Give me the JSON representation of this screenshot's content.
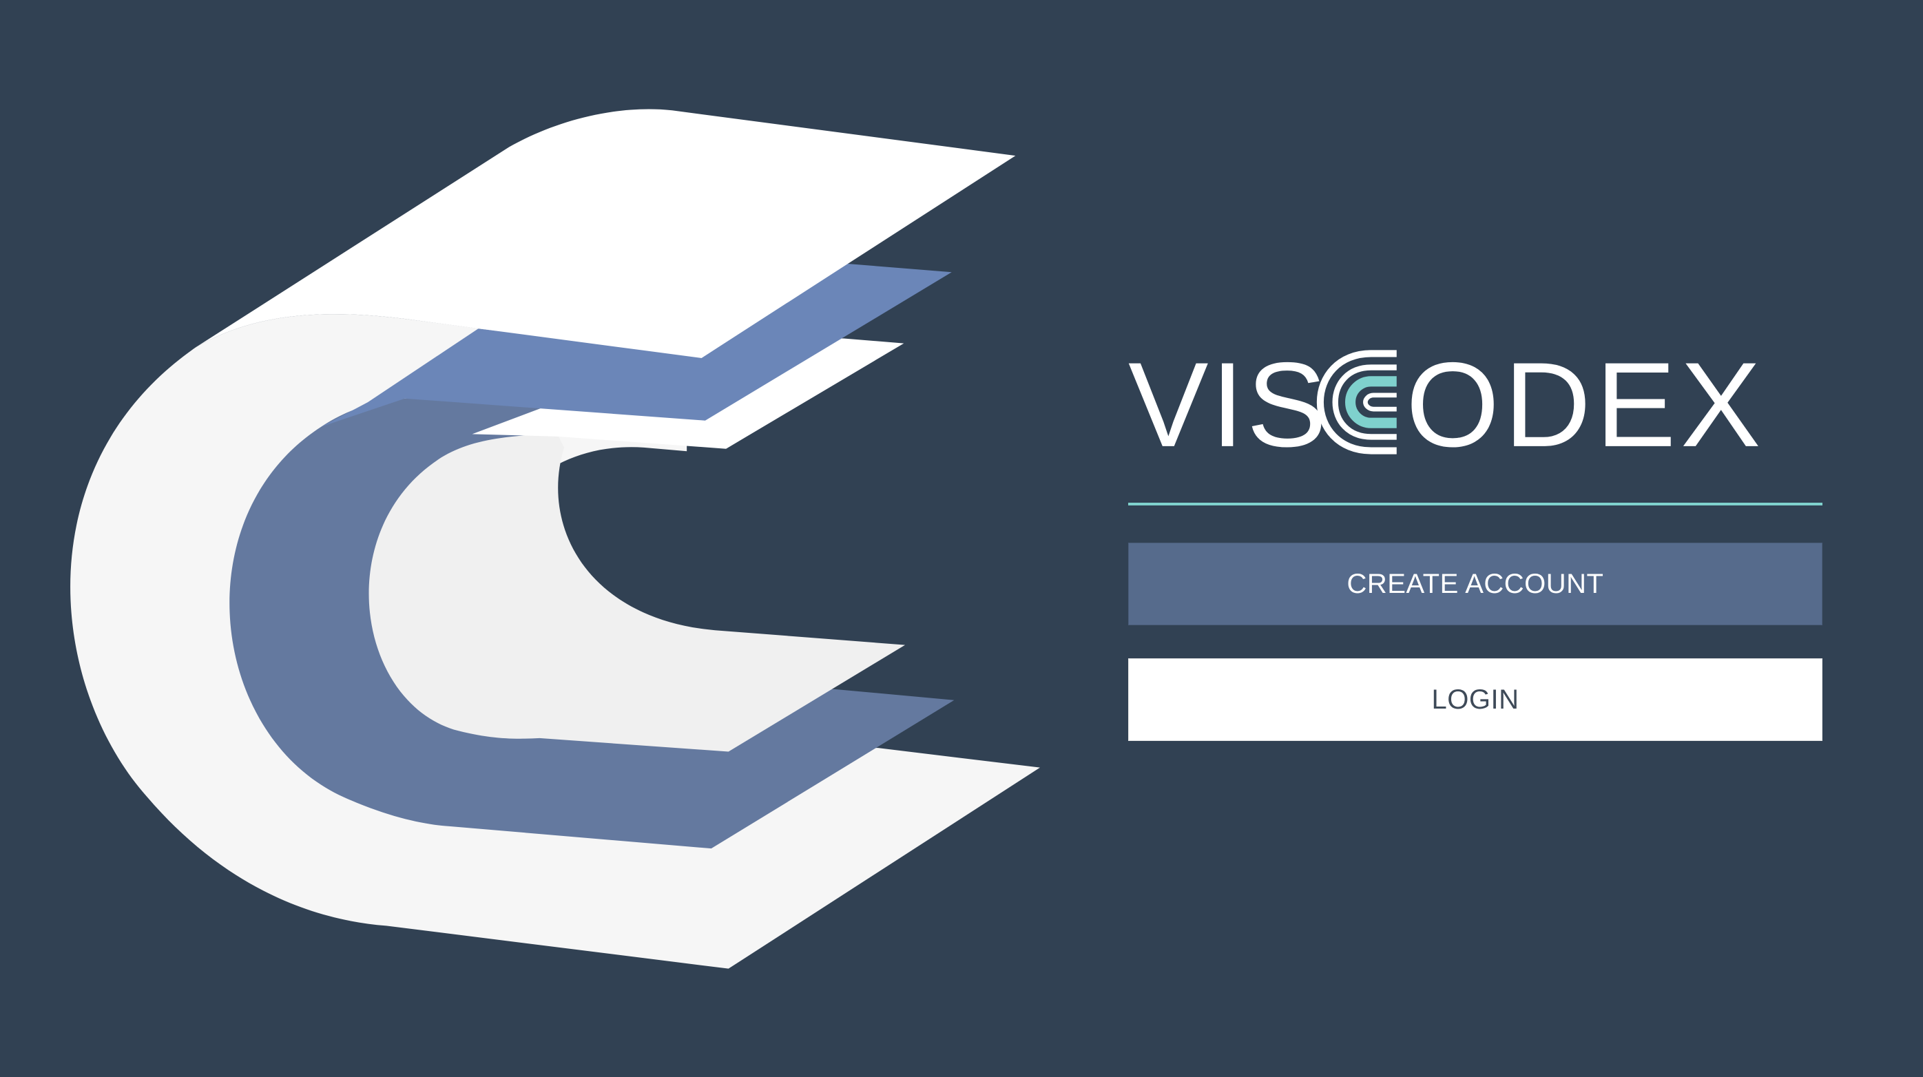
{
  "brand": {
    "name": "VISCODEX",
    "wordmark_left": "VIS",
    "wordmark_right": "ODEX"
  },
  "actions": {
    "create_account_label": "CREATE ACCOUNT",
    "login_label": "LOGIN"
  },
  "colors": {
    "background": "#314153",
    "accent_teal": "#7fd1cd",
    "layer_blue": "#6b86b8",
    "layer_slate": "#64799f",
    "primary_button": "#566b8c",
    "secondary_button": "#ffffff",
    "white": "#ffffff"
  },
  "icons": {
    "logo_mark": "stacked-c-layers-logo",
    "wordmark_c": "concentric-c-icon"
  }
}
